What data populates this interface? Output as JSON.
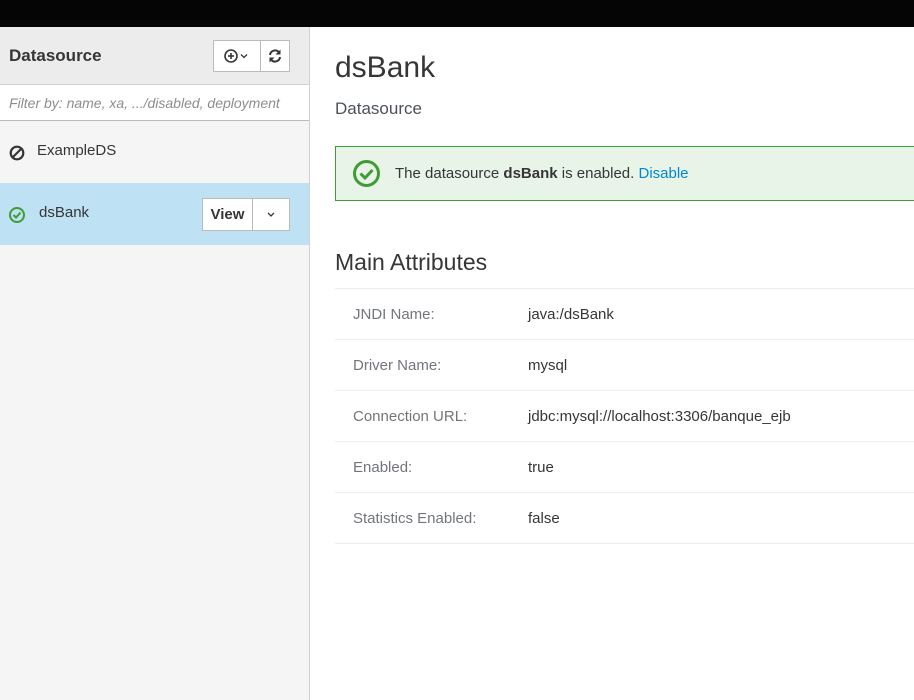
{
  "sidebar": {
    "title": "Datasource",
    "add_icon": "plus-circle-icon",
    "refresh_icon": "refresh-icon",
    "filter_placeholder": "Filter by: name, xa, .../disabled, deployment",
    "items": [
      {
        "label": "ExampleDS",
        "icon": "disabled-icon",
        "status": "disabled"
      },
      {
        "label": "dsBank",
        "icon": "check-circle-icon",
        "status": "enabled",
        "selected": true,
        "view_label": "View"
      }
    ]
  },
  "main": {
    "title": "dsBank",
    "subtitle": "Datasource",
    "alert": {
      "prefix": "The datasource ",
      "name": "dsBank",
      "suffix": " is enabled. ",
      "link": "Disable"
    },
    "section_title": "Main Attributes",
    "attributes": [
      {
        "name": "JNDI Name:",
        "value": "java:/dsBank"
      },
      {
        "name": "Driver Name:",
        "value": "mysql"
      },
      {
        "name": "Connection URL:",
        "value": "jdbc:mysql://localhost:3306/banque_ejb"
      },
      {
        "name": "Enabled:",
        "value": "true"
      },
      {
        "name": "Statistics Enabled:",
        "value": "false"
      }
    ]
  },
  "colors": {
    "topbar": "#050505",
    "selected_item": "#bee1f4",
    "success": "#3f9c35",
    "link": "#0088ce"
  }
}
